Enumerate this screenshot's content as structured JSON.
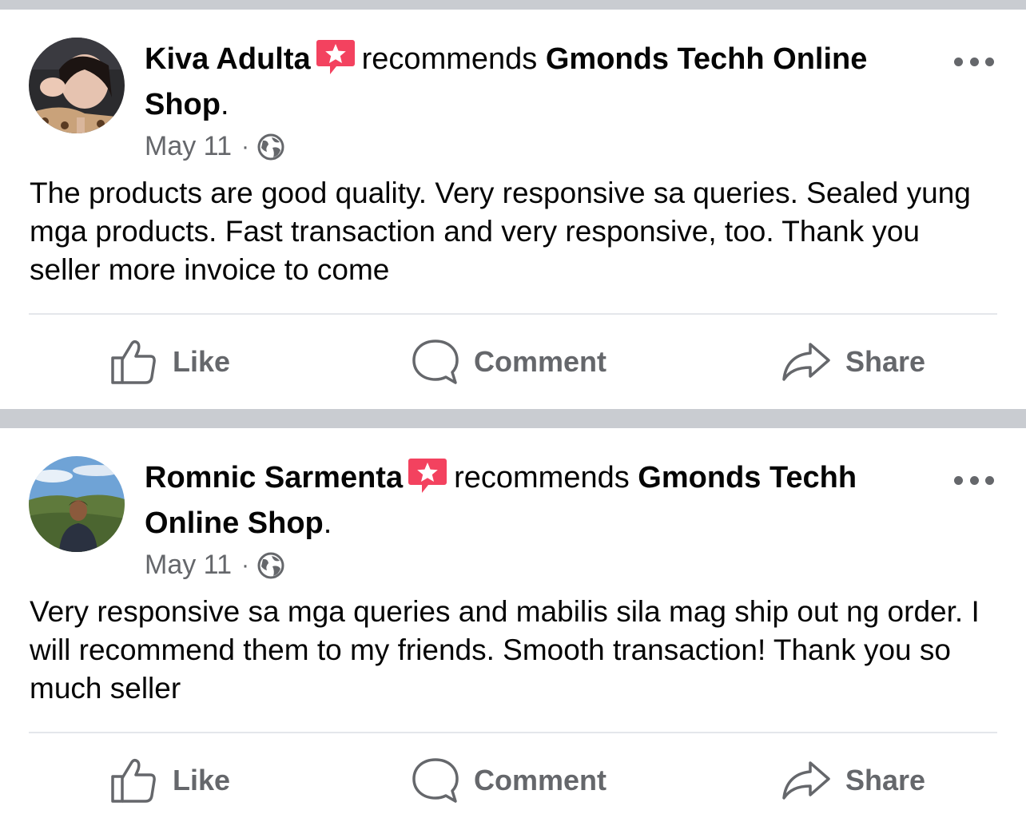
{
  "posts": [
    {
      "author": "Kiva Adulta",
      "verb": "recommends",
      "page": "Gmonds Techh Online Shop",
      "period": ".",
      "date": "May 11",
      "separator": "·",
      "text": "The products are good quality. Very responsive sa queries. Sealed yung mga products. Fast transaction and very responsive, too. Thank you seller more invoice to come",
      "actions": {
        "like": "Like",
        "comment": "Comment",
        "share": "Share"
      }
    },
    {
      "author": "Romnic Sarmenta",
      "verb": "recommends",
      "page": "Gmonds Techh Online Shop",
      "period": ".",
      "date": "May 11",
      "separator": "·",
      "text": "Very responsive sa mga queries and mabilis sila mag ship out ng order. I will recommend them to my friends. Smooth transaction! Thank you so much seller",
      "actions": {
        "like": "Like",
        "comment": "Comment",
        "share": "Share"
      }
    }
  ],
  "icons": {
    "recommend_badge": "recommend-star-icon",
    "more": "more-options-icon",
    "privacy": "globe-icon",
    "like": "thumbs-up-icon",
    "comment": "comment-bubble-icon",
    "share": "share-arrow-icon"
  },
  "colors": {
    "badge": "#f3425f",
    "secondary_text": "#65676b",
    "separator_bg": "#c9ccd1"
  }
}
